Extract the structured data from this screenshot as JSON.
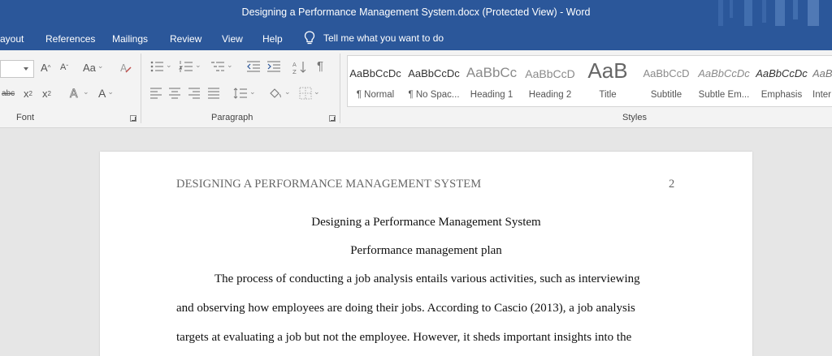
{
  "window": {
    "title": "Designing a Performance Management System.docx (Protected View)  -  Word"
  },
  "menu": {
    "tabs": [
      "ayout",
      "References",
      "Mailings",
      "Review",
      "View",
      "Help"
    ],
    "tell_me": "Tell me what you want to do"
  },
  "ribbon": {
    "font_group_label": "Font",
    "paragraph_group_label": "Paragraph",
    "styles_group_label": "Styles",
    "font_buttons": {
      "grow": "A",
      "shrink": "A",
      "change_case": "Aa",
      "strikethrough": "abc",
      "subscript": "x",
      "superscript": "x",
      "font_color": "A"
    },
    "paragraph_buttons": {
      "pilcrow": "¶"
    },
    "styles": [
      {
        "sample": "AaBbCcDc",
        "name": "¶ Normal"
      },
      {
        "sample": "AaBbCcDc",
        "name": "¶ No Spac..."
      },
      {
        "sample": "AaBbCc",
        "name": "Heading 1"
      },
      {
        "sample": "AaBbCcD",
        "name": "Heading 2"
      },
      {
        "sample": "AaB",
        "name": "Title"
      },
      {
        "sample": "AaBbCcD",
        "name": "Subtitle"
      },
      {
        "sample": "AaBbCcDc",
        "name": "Subtle Em..."
      },
      {
        "sample": "AaBbCcDc",
        "name": "Emphasis"
      },
      {
        "sample": "AaBb",
        "name": "Inter"
      }
    ]
  },
  "document": {
    "header": "DESIGNING A PERFORMANCE MANAGEMENT SYSTEM",
    "page_number": "2",
    "title": "Designing a Performance Management System",
    "subtitle": "Performance management plan",
    "lines": [
      "The process of conducting a job analysis entails various activities, such as interviewing",
      "and observing how employees are doing their jobs. According to Cascio (2013), a job analysis",
      "targets at evaluating a job but not the employee. However, it sheds important insights into the"
    ]
  },
  "colors": {
    "accent": "#2b579a",
    "ribbon": "#f3f3f3",
    "canvas": "#e6e6e6"
  }
}
